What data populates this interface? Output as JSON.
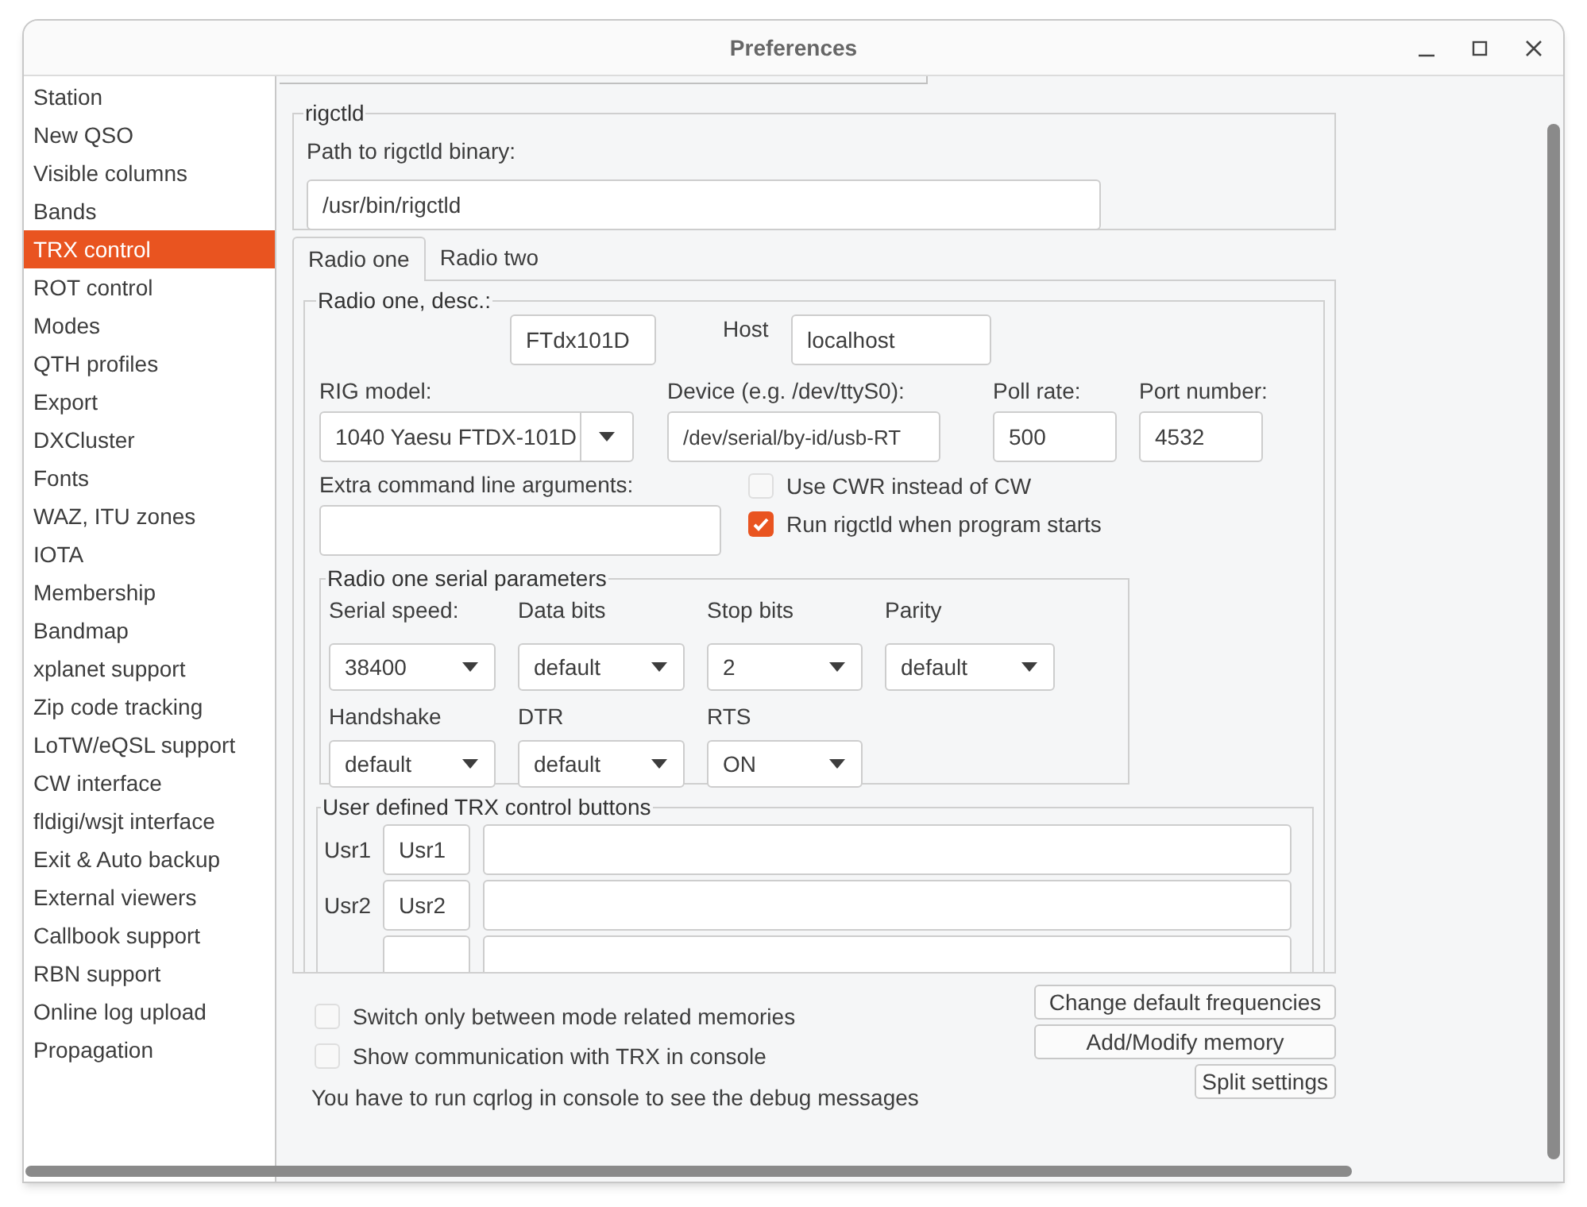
{
  "window": {
    "title": "Preferences"
  },
  "sidebar": {
    "items": [
      {
        "label": "Station",
        "selected": false
      },
      {
        "label": "New QSO",
        "selected": false
      },
      {
        "label": "Visible columns",
        "selected": false
      },
      {
        "label": "Bands",
        "selected": false
      },
      {
        "label": "TRX control",
        "selected": true
      },
      {
        "label": "ROT control",
        "selected": false
      },
      {
        "label": "Modes",
        "selected": false
      },
      {
        "label": "QTH profiles",
        "selected": false
      },
      {
        "label": "Export",
        "selected": false
      },
      {
        "label": "DXCluster",
        "selected": false
      },
      {
        "label": "Fonts",
        "selected": false
      },
      {
        "label": "WAZ, ITU zones",
        "selected": false
      },
      {
        "label": "IOTA",
        "selected": false
      },
      {
        "label": "Membership",
        "selected": false
      },
      {
        "label": "Bandmap",
        "selected": false
      },
      {
        "label": "xplanet support",
        "selected": false
      },
      {
        "label": "Zip code tracking",
        "selected": false
      },
      {
        "label": "LoTW/eQSL support",
        "selected": false
      },
      {
        "label": "CW interface",
        "selected": false
      },
      {
        "label": "fldigi/wsjt interface",
        "selected": false
      },
      {
        "label": "Exit & Auto backup",
        "selected": false
      },
      {
        "label": "External viewers",
        "selected": false
      },
      {
        "label": "Callbook support",
        "selected": false
      },
      {
        "label": "RBN support",
        "selected": false
      },
      {
        "label": "Online log upload",
        "selected": false
      },
      {
        "label": "Propagation",
        "selected": false
      }
    ]
  },
  "rigctld": {
    "title": "rigctld",
    "path_label": "Path to rigctld binary:",
    "path_value": "/usr/bin/rigctld"
  },
  "radio_tabs": [
    {
      "label": "Radio one",
      "selected": true
    },
    {
      "label": "Radio two",
      "selected": false
    }
  ],
  "radio": {
    "title": "Radio one, desc.:",
    "desc_value": "FTdx101D",
    "host_label": "Host",
    "host_value": "localhost",
    "rig_model_label": "RIG model:",
    "rig_model_value": "1040 Yaesu FTDX-101D",
    "device_label": "Device (e.g. /dev/ttyS0):",
    "device_value": "/dev/serial/by-id/usb-RT",
    "poll_label": "Poll rate:",
    "poll_value": "500",
    "port_label": "Port number:",
    "port_value": "4532",
    "extra_label": "Extra command line arguments:",
    "options": [
      {
        "label": "Use CWR instead of CW",
        "checked": false
      },
      {
        "label": "Run rigctld when program starts",
        "checked": true
      }
    ]
  },
  "serial": {
    "title": "Radio one serial parameters",
    "fields": [
      {
        "label": "Serial speed:",
        "value": "38400"
      },
      {
        "label": "Data bits",
        "value": "default"
      },
      {
        "label": "Stop bits",
        "value": "2"
      },
      {
        "label": "Parity",
        "value": "default"
      },
      {
        "label": "Handshake",
        "value": "default"
      },
      {
        "label": "DTR",
        "value": "default"
      },
      {
        "label": "RTS",
        "value": "ON"
      }
    ]
  },
  "user_buttons": {
    "title": "User defined TRX control buttons",
    "rows": [
      {
        "label": "Usr1",
        "name": "Usr1"
      },
      {
        "label": "Usr2",
        "name": "Usr2"
      }
    ]
  },
  "bottom": {
    "options": [
      {
        "label": "Switch only between mode related memories",
        "checked": false
      },
      {
        "label": "Show communication with TRX in console",
        "checked": false
      }
    ],
    "note": "You have to run cqrlog in console to see the debug messages",
    "buttons": [
      "Change default frequencies",
      "Add/Modify memory",
      "Split settings"
    ]
  }
}
